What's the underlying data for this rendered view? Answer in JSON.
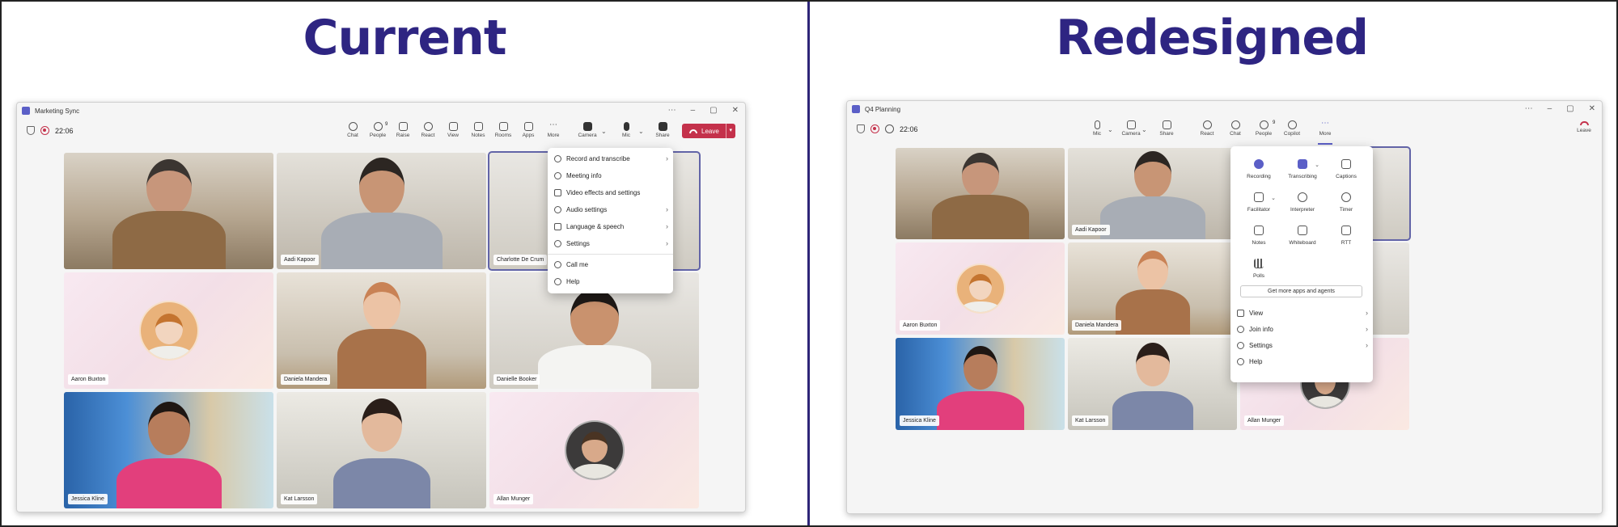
{
  "left": {
    "heading": "Current",
    "window_title": "Marketing Sync",
    "timer": "22:06",
    "toolbar": [
      {
        "label": "Chat",
        "icon": "chat-icon"
      },
      {
        "label": "People",
        "icon": "people-icon",
        "badge": "9"
      },
      {
        "label": "Raise",
        "icon": "hand-icon"
      },
      {
        "label": "React",
        "icon": "react-icon"
      },
      {
        "label": "View",
        "icon": "view-icon"
      },
      {
        "label": "Notes",
        "icon": "notes-icon"
      },
      {
        "label": "Rooms",
        "icon": "rooms-icon"
      },
      {
        "label": "Apps",
        "icon": "apps-icon"
      },
      {
        "label": "More",
        "icon": "more-icon"
      },
      {
        "label": "Camera",
        "icon": "camera-icon"
      },
      {
        "label": "Mic",
        "icon": "mic-icon"
      },
      {
        "label": "Share",
        "icon": "share-icon"
      }
    ],
    "leave_label": "Leave",
    "participants": [
      "",
      "Aadi Kapoor",
      "Charlotte De Crum",
      "Aaron Buxton",
      "Daniela Mandera",
      "Danielle Booker",
      "Jessica Kline",
      "Kat Larsson",
      "Allan Munger"
    ],
    "menu": {
      "items": [
        {
          "label": "Record and transcribe",
          "has_submenu": true
        },
        {
          "label": "Meeting info",
          "has_submenu": false
        },
        {
          "label": "Video effects and settings",
          "has_submenu": false
        },
        {
          "label": "Audio settings",
          "has_submenu": true
        },
        {
          "label": "Language & speech",
          "has_submenu": true
        },
        {
          "label": "Settings",
          "has_submenu": true
        }
      ],
      "footer_items": [
        {
          "label": "Call me"
        },
        {
          "label": "Help"
        }
      ]
    }
  },
  "right": {
    "heading": "Redesigned",
    "window_title": "Q4 Planning",
    "timer": "22:06",
    "toolbar": [
      {
        "label": "Mic",
        "icon": "mic-icon"
      },
      {
        "label": "Camera",
        "icon": "camera-icon"
      },
      {
        "label": "Share",
        "icon": "share-icon"
      },
      {
        "label": "React",
        "icon": "react-icon"
      },
      {
        "label": "Chat",
        "icon": "chat-icon"
      },
      {
        "label": "People",
        "icon": "people-icon",
        "badge": "9"
      },
      {
        "label": "Copilot",
        "icon": "copilot-icon"
      },
      {
        "label": "More",
        "icon": "more-icon"
      }
    ],
    "leave_label": "Leave",
    "participants": [
      "",
      "Aadi Kapoor",
      "",
      "Aaron Buxton",
      "Daniela Mandera",
      "",
      "Jessica Kline",
      "Kat Larsson",
      "Allan Munger"
    ],
    "menu": {
      "grid": [
        {
          "label": "Recording",
          "icon": "recording-icon"
        },
        {
          "label": "Transcribing",
          "icon": "transcribing-icon"
        },
        {
          "label": "Captions",
          "icon": "captions-icon"
        },
        {
          "label": "Facilitator",
          "icon": "facilitator-icon"
        },
        {
          "label": "Interpreter",
          "icon": "interpreter-icon"
        },
        {
          "label": "Timer",
          "icon": "timer-icon"
        },
        {
          "label": "Notes",
          "icon": "notes-icon"
        },
        {
          "label": "Whiteboard",
          "icon": "whiteboard-icon"
        },
        {
          "label": "RTT",
          "icon": "rtt-icon"
        },
        {
          "label": "Polls",
          "icon": "polls-icon"
        }
      ],
      "get_more": "Get more apps and agents",
      "items": [
        {
          "label": "View",
          "has_submenu": true
        },
        {
          "label": "Join info",
          "has_submenu": true
        },
        {
          "label": "Settings",
          "has_submenu": true
        },
        {
          "label": "Help",
          "has_submenu": false
        }
      ]
    }
  },
  "colors": {
    "heading": "#2e2582",
    "accent": "#5b5fc7",
    "leave": "#c4314b",
    "divider": "#2e2578"
  }
}
